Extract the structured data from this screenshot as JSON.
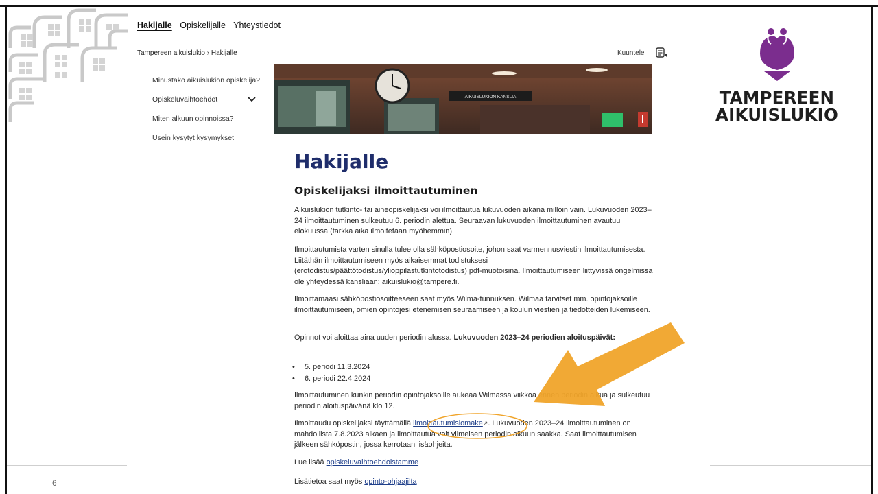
{
  "slide": {
    "number": "6"
  },
  "logo": {
    "line1": "TAMPEREEN",
    "line2": "AIKUISLUKIO",
    "color": "#7b2d8e"
  },
  "nav": {
    "items": [
      "Hakijalle",
      "Opiskelijalle",
      "Yhteystiedot"
    ]
  },
  "breadcrumb": {
    "home": "Tampereen aikuislukio",
    "separator": "›",
    "current": "Hakijalle"
  },
  "listen": {
    "label": "Kuuntele"
  },
  "sidebar": {
    "items": [
      "Minustako aikuislukion opiskelija?",
      "Opiskeluvaihtoehdot",
      "Miten alkuun opinnoissa?",
      "Usein kysytyt kysymykset"
    ]
  },
  "hero": {
    "sign": "AIKUISLUKION KANSLIA"
  },
  "page": {
    "title": "Hakijalle",
    "subtitle": "Opiskelijaksi ilmoittautuminen",
    "p1": "Aikuislukion tutkinto- tai aineopiskelijaksi voi ilmoittautua lukuvuoden aikana milloin vain. Lukuvuoden 2023–24 ilmoittautuminen sulkeutuu 6. periodin alettua. Seuraavan lukuvuoden ilmoittautuminen avautuu elokuussa (tarkka aika ilmoitetaan myöhemmin).",
    "p2": "Ilmoittautumista varten sinulla tulee olla sähköpostiosoite, johon saat varmennusviestin ilmoittautumisesta. Liitäthän ilmoittautumiseen myös aikaisemmat todistuksesi (erotodistus/päättötodistus/ylioppilastutkintotodistus) pdf-muotoisina. Ilmoittautumiseen liittyvissä ongelmissa ole yhteydessä kansliaan: aikuislukio@tampere.fi.",
    "p3": "Ilmoittamaasi sähköpostiosoitteeseen saat myös Wilma-tunnuksen. Wilmaa tarvitset mm. opintojaksoille ilmoittautumiseen, omien opintojesi etenemisen seuraamiseen ja koulun viestien ja tiedotteiden lukemiseen.",
    "p4_prefix": "Opinnot voi aloittaa aina uuden periodin alussa. ",
    "p4_bold": "Lukuvuoden 2023–24 periodien aloituspäivät",
    "p4_suffix": ":",
    "bullets": [
      "5. periodi 11.3.2024",
      "6. periodi 22.4.2024"
    ],
    "p5": "Ilmoittautuminen kunkin periodin opintojaksoille aukeaa Wilmassa viikkoa ennen periodin alkua ja sulkeutuu periodin aloituspäivänä klo 12.",
    "p6_prefix": "Ilmoittaudu opiskelijaksi täyttämällä ",
    "p6_link": "ilmoittautumislomake",
    "p6_ext": "↗",
    "p6_suffix": ". Lukuvuoden 2023–24 ilmoittautuminen on mahdollista 7.8.2023 alkaen ja ilmoittautua voit viimeisen periodin alkuun saakka. Saat ilmoittautumisen jälkeen sähköpostin, jossa kerrotaan lisäohjeita.",
    "p7_prefix": "Lue lisää ",
    "p7_link": "opiskeluvaihtoehdoistamme",
    "p8_prefix": "Lisätietoa saat myös ",
    "p8_link": "opinto-ohjaajilta"
  },
  "annotation": {
    "arrow_color": "#f0a42a",
    "circle_color": "#f0a42a"
  },
  "icons": [
    "decorative-pattern-icon",
    "logo-icon",
    "listen-icon",
    "chevron-down-icon",
    "external-link-icon",
    "annotation-arrow-icon"
  ]
}
